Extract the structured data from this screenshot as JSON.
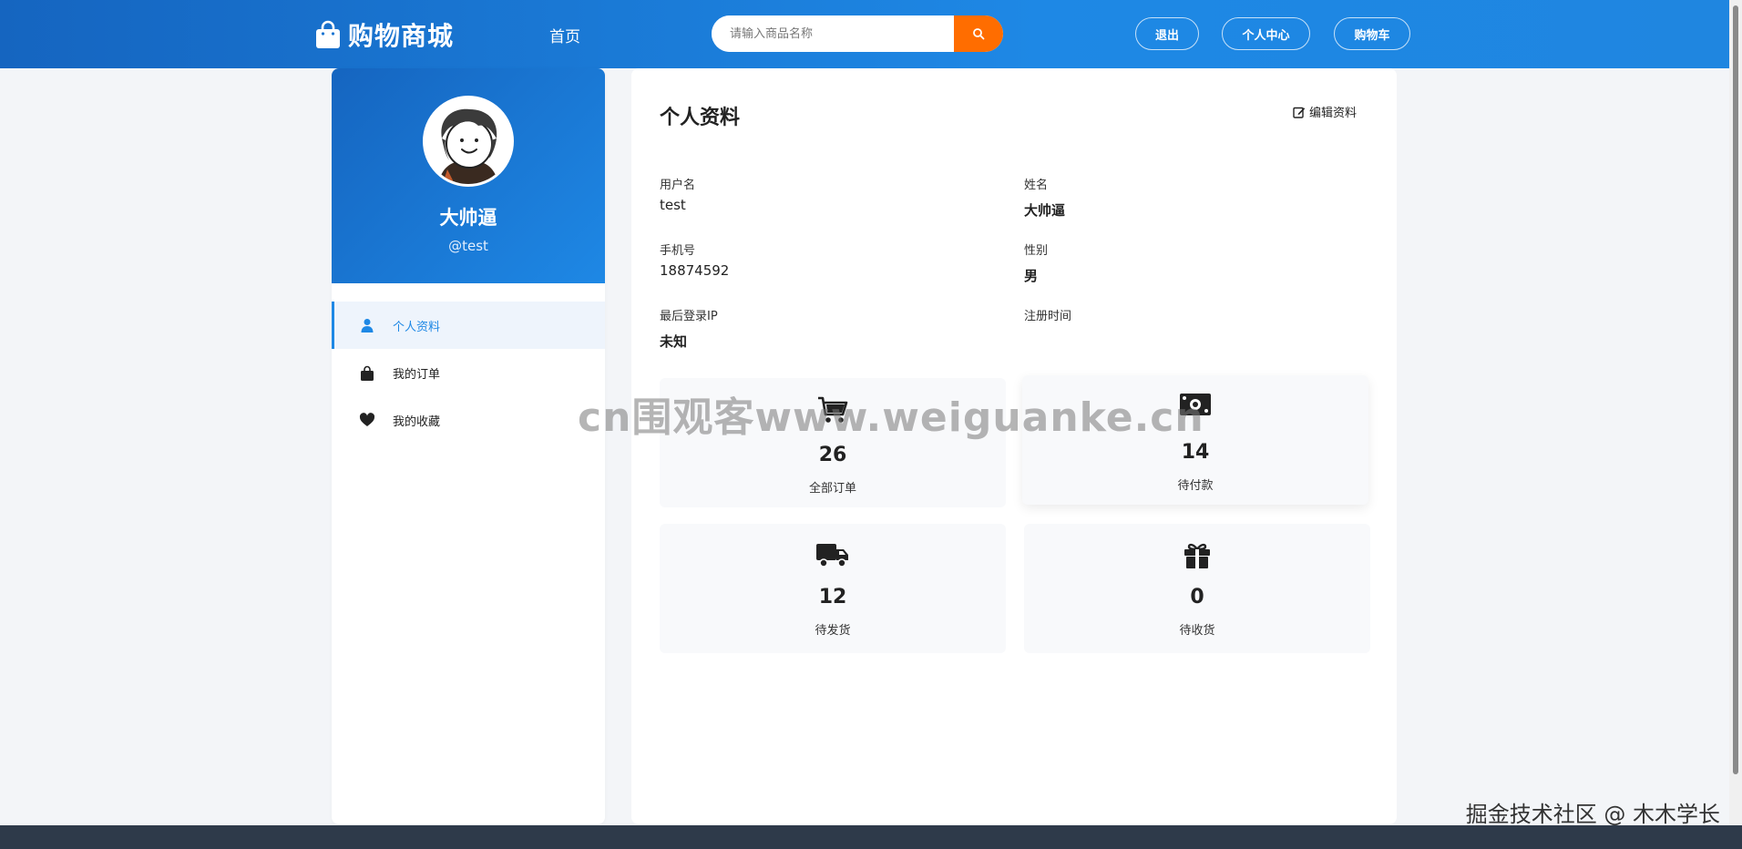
{
  "header": {
    "brand": "购物商城",
    "nav_home": "首页",
    "search_placeholder": "请输入商品名称",
    "logout": "退出",
    "user_center": "个人中心",
    "cart": "购物车"
  },
  "sidebar": {
    "display_name": "大帅逼",
    "handle": "@test",
    "menu": [
      {
        "label": "个人资料",
        "icon": "user-icon",
        "active": true
      },
      {
        "label": "我的订单",
        "icon": "shopping-bag-icon",
        "active": false
      },
      {
        "label": "我的收藏",
        "icon": "heart-icon",
        "active": false
      }
    ]
  },
  "main": {
    "title": "个人资料",
    "edit_label": "编辑资料",
    "fields": {
      "username_label": "用户名",
      "username_value": "test",
      "name_label": "姓名",
      "name_value": "大帅逼",
      "phone_label": "手机号",
      "phone_value": "18874592",
      "gender_label": "性别",
      "gender_value": "男",
      "ip_label": "最后登录IP",
      "ip_value": "未知",
      "register_label": "注册时间"
    },
    "stats": [
      {
        "label": "全部订单",
        "value": "26",
        "icon": "shopping-cart-icon"
      },
      {
        "label": "待付款",
        "value": "14",
        "icon": "money-bill-icon"
      },
      {
        "label": "待发货",
        "value": "12",
        "icon": "truck-icon"
      },
      {
        "label": "待收货",
        "value": "0",
        "icon": "gift-icon"
      }
    ]
  },
  "overlay": {
    "watermark": "cn围观客www.weiguanke.cn",
    "credit": "掘金技术社区 @ 木木学长"
  },
  "colors": {
    "primary": "#1e88e5",
    "primary_dark": "#1565c0",
    "search_button": "#ff6d00",
    "footer": "#2e3a4a"
  }
}
